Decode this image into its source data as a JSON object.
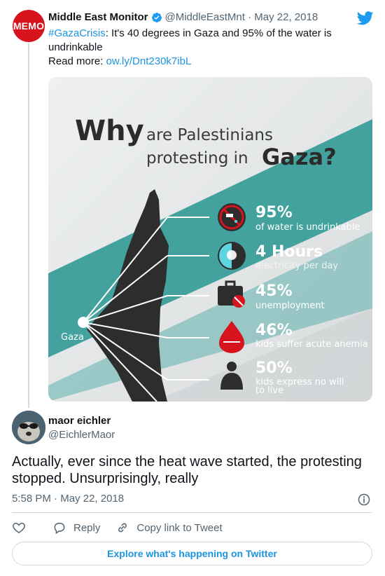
{
  "tweet": {
    "author_name": "Middle East Monitor",
    "author_handle": "@MiddleEastMnt",
    "date": "May 22, 2018",
    "avatar_text": "MEMO",
    "hashtag": "#GazaCrisis",
    "text": ": It's 40 degrees in Gaza and 95% of the water is undrinkable",
    "read_more_label": "Read more:",
    "link": "ow.ly/Dnt230k7ibL"
  },
  "infographic": {
    "title_why": "Why",
    "title_rest1": "are Palestinians",
    "title_rest2": "protesting in",
    "title_gaza": "Gaza?",
    "map_label": "Gaza",
    "stats": [
      {
        "value": "95%",
        "label": "of water is undrinkable"
      },
      {
        "value": "4 Hours",
        "label": "electricity per day"
      },
      {
        "value": "45%",
        "label": "unemployment"
      },
      {
        "value": "46%",
        "label": "kids suffer acute anemia"
      },
      {
        "value": "50%",
        "label_line1": "kids express no will",
        "label_line2": "to live"
      }
    ],
    "colors": {
      "teal": "#3a9e9a",
      "dark": "#2d2d2d",
      "red": "#d7141e",
      "cyan": "#5fd3e0"
    }
  },
  "reply": {
    "author_name": "maor eichler",
    "author_handle": "@EichlerMaor",
    "text": "Actually, ever since the heat wave started, the protesting stopped. Unsurprisingly, really",
    "time": "5:58 PM",
    "date": "May 22, 2018"
  },
  "actions": {
    "reply_label": "Reply",
    "copy_label": "Copy link to Tweet"
  },
  "explore_label": "Explore what's happening on Twitter",
  "colors": {
    "link": "#1b95e0",
    "muted": "#536471"
  }
}
